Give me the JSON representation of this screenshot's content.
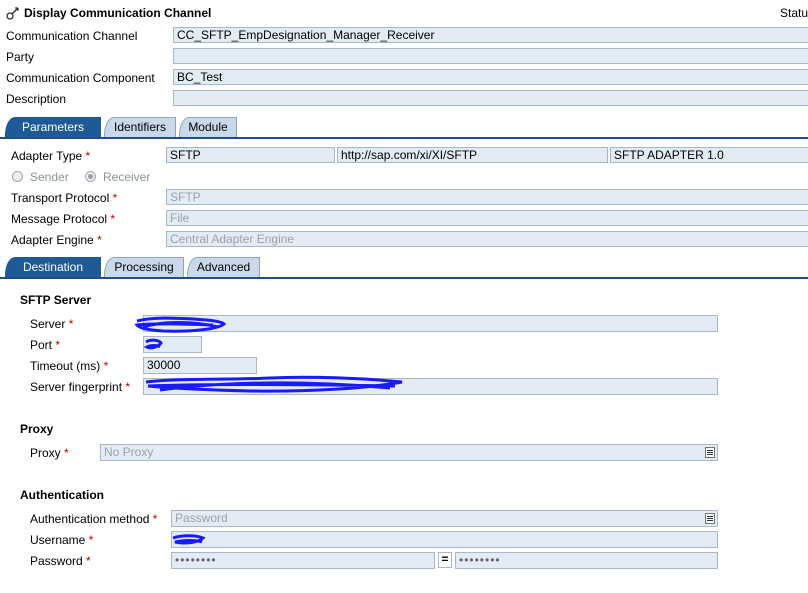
{
  "header": {
    "title": "Display Communication Channel",
    "status": "Statu"
  },
  "channel": {
    "communication_channel_label": "Communication Channel",
    "communication_channel_value": "CC_SFTP_EmpDesignation_Manager_Receiver",
    "party_label": "Party",
    "party_value": "",
    "communication_component_label": "Communication Component",
    "communication_component_value": "BC_Test",
    "description_label": "Description",
    "description_value": ""
  },
  "top_tabs": [
    {
      "label": "Parameters",
      "active": true
    },
    {
      "label": "Identifiers",
      "active": false
    },
    {
      "label": "Module",
      "active": false
    }
  ],
  "parameters": {
    "adapter_type_label": "Adapter Type",
    "adapter_type_value": "SFTP",
    "adapter_namespace": "http://sap.com/xi/XI/SFTP",
    "adapter_version": "SFTP ADAPTER 1.0",
    "sender_label": "Sender",
    "receiver_label": "Receiver",
    "direction_selected": "Receiver",
    "transport_protocol_label": "Transport Protocol",
    "transport_protocol_value": "SFTP",
    "message_protocol_label": "Message Protocol",
    "message_protocol_value": "File",
    "adapter_engine_label": "Adapter Engine",
    "adapter_engine_value": "Central Adapter Engine",
    "required_marker": "*"
  },
  "sub_tabs": [
    {
      "label": "Destination",
      "active": true
    },
    {
      "label": "Processing",
      "active": false
    },
    {
      "label": "Advanced",
      "active": false
    }
  ],
  "sftp_server": {
    "section_title": "SFTP Server",
    "server_label": "Server",
    "server_value": "",
    "port_label": "Port",
    "port_value": "",
    "timeout_label": "Timeout (ms)",
    "timeout_value": "30000",
    "fingerprint_label": "Server fingerprint",
    "fingerprint_value": ""
  },
  "proxy": {
    "section_title": "Proxy",
    "proxy_label": "Proxy",
    "proxy_value": "No Proxy"
  },
  "authentication": {
    "section_title": "Authentication",
    "method_label": "Authentication method",
    "method_value": "Password",
    "username_label": "Username",
    "username_value": "",
    "password_label": "Password",
    "password_value": "••••••••",
    "password_confirm_value": "••••••••",
    "equals_symbol": "="
  },
  "colors": {
    "active_tab": "#1e5a96",
    "inactive_tab": "#c9d9ea",
    "field_bg": "#e3ebf4",
    "field_border": "#a8b7c9",
    "required": "#c00000",
    "redaction": "#1a1aff"
  }
}
